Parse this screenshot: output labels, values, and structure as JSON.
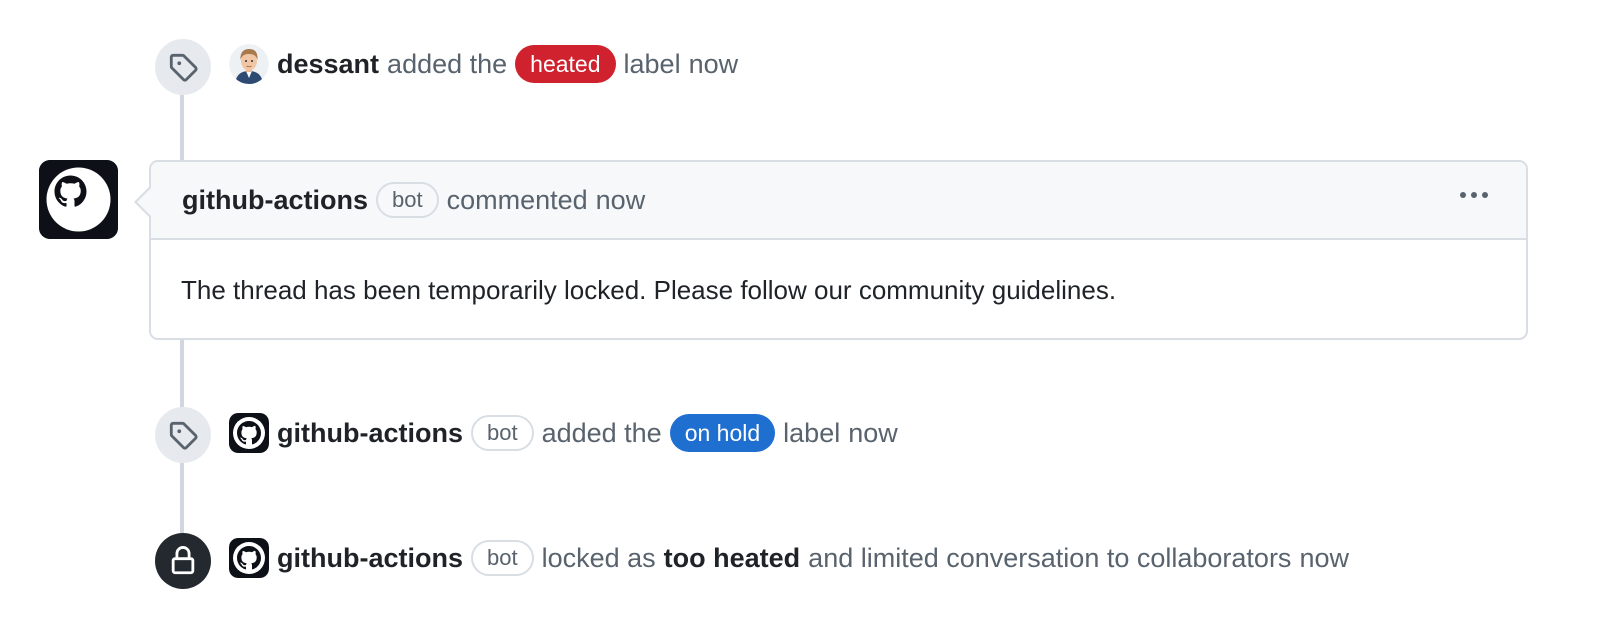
{
  "timeline": {
    "event_1": {
      "actor": "dessant",
      "before": "added the",
      "label": {
        "text": "heated",
        "color": "#cf222e"
      },
      "after": "label",
      "time": "now"
    },
    "comment": {
      "author": "github-actions",
      "bot_badge": "bot",
      "action": "commented",
      "time": "now",
      "body": "The thread has been temporarily locked. Please follow our community guidelines.",
      "menu_icon": "kebab-horizontal-icon"
    },
    "event_2": {
      "actor": "github-actions",
      "bot_badge": "bot",
      "before": "added the",
      "label": {
        "text": "on hold",
        "color": "#1f6fd0"
      },
      "after": "label",
      "time": "now"
    },
    "event_3": {
      "actor": "github-actions",
      "bot_badge": "bot",
      "before": "locked as",
      "reason": "too heated",
      "after": "and limited conversation to collaborators",
      "time": "now"
    }
  },
  "icons": {
    "label_event": "tag-icon",
    "lock_event": "lock-icon",
    "bot_avatar": "github-mark-icon",
    "user_avatar": "avatar"
  },
  "colors": {
    "timeline_line": "#d0d7de",
    "badge_bg": "#e6e9ee",
    "lock_badge_bg": "#24292f",
    "muted_text": "#59636e"
  }
}
